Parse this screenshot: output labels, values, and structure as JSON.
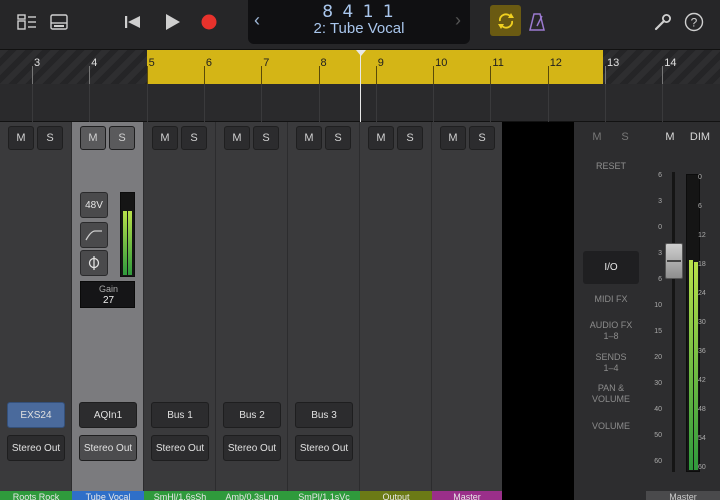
{
  "transport": {
    "position": "8  4  1      1",
    "track_name": "2: Tube Vocal"
  },
  "ruler": {
    "bars": [
      "3",
      "4",
      "5",
      "6",
      "7",
      "8",
      "9",
      "10",
      "11",
      "12",
      "13",
      "14"
    ]
  },
  "strips": [
    {
      "name": "Roots Rock",
      "instrument": "EXS24",
      "output": "Stereo Out",
      "color": "#2f9a3c"
    },
    {
      "name": "Tube Vocal",
      "instrument": "AQIn1",
      "output": "Stereo Out",
      "color": "#2f6fc8"
    },
    {
      "name": "SmHl/1.6sSh",
      "instrument": "Bus 1",
      "output": "Stereo Out",
      "color": "#2f9a3c"
    },
    {
      "name": "Amb/0.3sLng",
      "instrument": "Bus 2",
      "output": "Stereo Out",
      "color": "#2f9a3c"
    },
    {
      "name": "SmPl/1.1sVc",
      "instrument": "Bus 3",
      "output": "Stereo Out",
      "color": "#2f9a3c"
    },
    {
      "name": "Output",
      "instrument": "",
      "output": "",
      "color": "#6b7a16"
    },
    {
      "name": "Master",
      "instrument": "",
      "output": "",
      "color": "#9a2f8a"
    }
  ],
  "mute_label": "M",
  "solo_label": "S",
  "selected_strip": {
    "phantom_label": "48V",
    "gain_label": "Gain",
    "gain_value": "27"
  },
  "master_panel": {
    "m_label": "M",
    "s_label": "S",
    "m2_label": "M",
    "dim_label": "DIM",
    "reset_label": "RESET",
    "tabs": [
      {
        "label": "I/O",
        "active": true
      },
      {
        "label": "MIDI FX",
        "active": false
      },
      {
        "label": "AUDIO FX\n1–8",
        "active": false
      },
      {
        "label": "SENDS\n1–4",
        "active": false
      },
      {
        "label": "PAN &\nVOLUME",
        "active": false
      },
      {
        "label": "VOLUME",
        "active": false
      }
    ],
    "scale_left": [
      "6",
      "3",
      "0",
      "3",
      "6",
      "10",
      "15",
      "20",
      "30",
      "40",
      "50",
      "60"
    ],
    "scale_right": [
      "0",
      "6",
      "12",
      "18",
      "24",
      "30",
      "36",
      "42",
      "48",
      "54",
      "60"
    ],
    "channel_label": "Master"
  },
  "colors": {
    "cycle": "#d4b516",
    "record": "#e8322c",
    "lcd_text": "#a9c6ec",
    "meter_green": "#3cb04c"
  }
}
